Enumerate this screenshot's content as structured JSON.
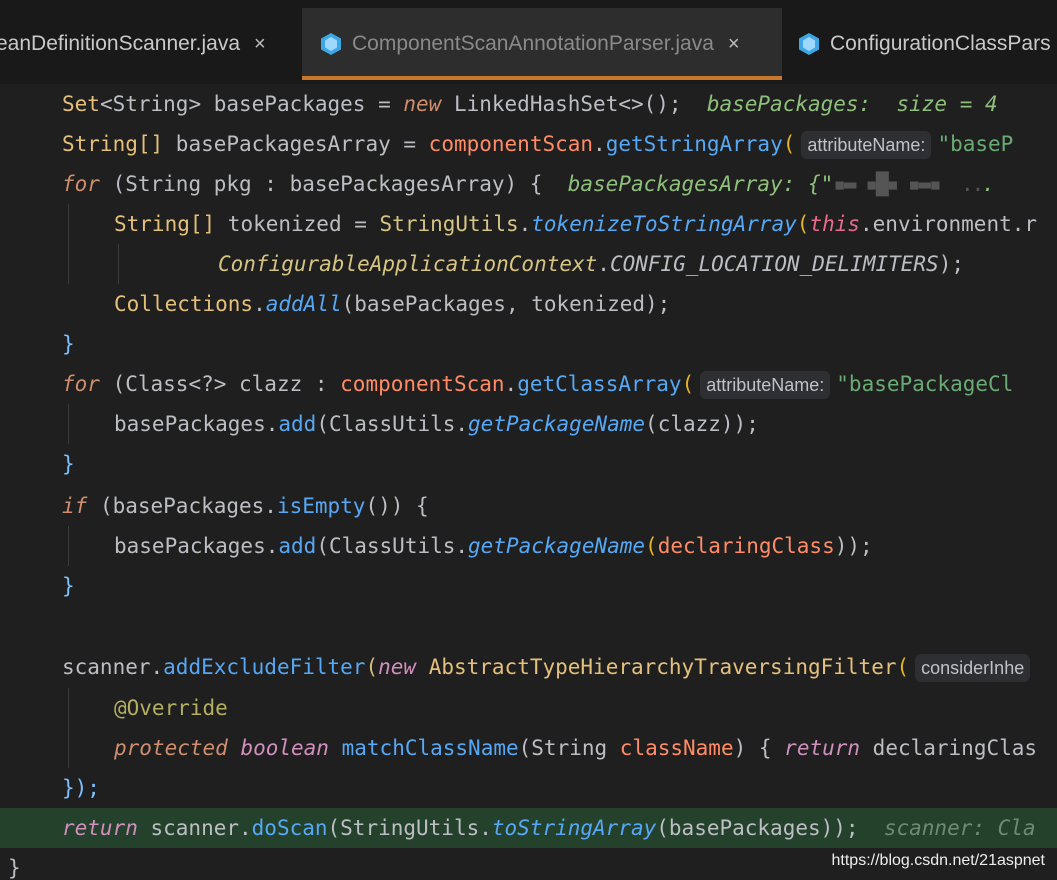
{
  "tabs": [
    {
      "label": "eanDefinitionScanner.java",
      "close": "×",
      "active": false
    },
    {
      "label": "ComponentScanAnnotationParser.java",
      "close": "×",
      "active": true
    },
    {
      "label": "ConfigurationClassPars",
      "active": false
    }
  ],
  "colors": {
    "active_tab_underline": "#c9782b",
    "current_line_bg": "#24412c",
    "editor_bg": "#1f1f1f"
  },
  "code": {
    "l1": {
      "t1": "Set",
      "t2": "<String>",
      "t3": " basePackages = ",
      "kw": "new",
      "t4": " LinkedHashSet<>();",
      "hint": "basePackages:  size = 4"
    },
    "l2": {
      "t1": "String[]",
      "t2": " basePackagesArray = ",
      "fld": "componentScan",
      "t3": ".",
      "fn": "getStringArray",
      "paren": "(",
      "inlay": "attributeName:",
      "str": "\"baseP"
    },
    "l3": {
      "kw": "for",
      "t1": " (String pkg : basePackagesArray) {",
      "hint": "basePackagesArray: {\"",
      "blur": "▪▬ ▪█▪ ▪▬▪  ..",
      "dots": "."
    },
    "l4": {
      "t1": "String[]",
      "t2": " tokenized = ",
      "cls": "StringUtils",
      "dot": ".",
      "sfn": "tokenizeToStringArray",
      "paren": "(",
      "this": "this",
      "t3": ".environment.r"
    },
    "l5": {
      "cls": "ConfigurableApplicationContext",
      "dot": ".",
      "sfld": "CONFIG_LOCATION_DELIMITERS",
      "t1": ");"
    },
    "l6": {
      "cls": "Collections",
      "dot": ".",
      "sfn": "addAll",
      "t1": "(basePackages, tokenized);"
    },
    "l7": {
      "t1": "}"
    },
    "l8": {
      "kw": "for",
      "t1": " (Class<?> clazz : ",
      "fld": "componentScan",
      "dot": ".",
      "fn": "getClassArray",
      "paren": "(",
      "inlay": "attributeName:",
      "str": "\"basePackageCl"
    },
    "l9": {
      "t1": "basePackages.",
      "fn": "add",
      "t2": "(ClassUtils.",
      "sfn": "getPackageName",
      "t3": "(clazz));"
    },
    "l10": {
      "t1": "}"
    },
    "l11": {
      "kw": "if",
      "t1": " (basePackages.",
      "fn": "isEmpty",
      "t2": "()) {"
    },
    "l12": {
      "t1": "basePackages.",
      "fn": "add",
      "t2": "(ClassUtils.",
      "sfn": "getPackageName",
      "paren": "(",
      "fld": "declaringClass",
      "t3": "));"
    },
    "l13": {
      "t1": "}"
    },
    "l15": {
      "t1": "scanner.",
      "fn": "addExcludeFilter",
      "paren": "(",
      "kw": "new",
      "cls": " AbstractTypeHierarchyTraversingFilter",
      "paren2": "(",
      "inlay": "considerInhe"
    },
    "l16": {
      "ann": "@Override"
    },
    "l17": {
      "kw1": "protected",
      "kw2": "boolean",
      "fn": "matchClassName",
      "t1": "(String ",
      "fld": "className",
      "t2": ") { ",
      "kw3": "return",
      "t3": " declaringClas"
    },
    "l18": {
      "t1": "});"
    },
    "l19": {
      "kw": "return",
      "t1": " scanner.",
      "fn": "doScan",
      "t2": "(StringUtils.",
      "sfn": "toStringArray",
      "t3": "(basePackages));",
      "hint": "scanner: Cla"
    },
    "l20": {
      "t1": "}"
    }
  },
  "watermark": "https://blog.csdn.net/21aspnet"
}
